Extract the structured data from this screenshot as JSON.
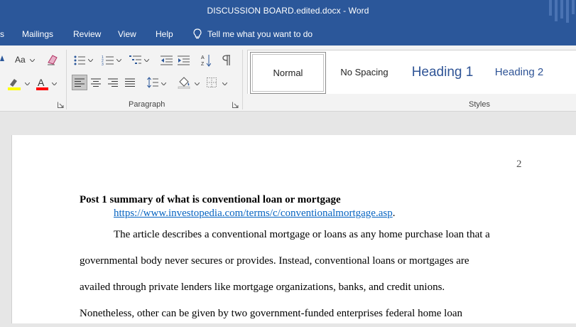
{
  "window": {
    "title": "DISCUSSION BOARD.edited.docx  -  Word"
  },
  "ribbon_tabs": [
    {
      "label": "s"
    },
    {
      "label": "Mailings"
    },
    {
      "label": "Review"
    },
    {
      "label": "View"
    },
    {
      "label": "Help"
    }
  ],
  "tell_me": {
    "label": "Tell me what you want to do"
  },
  "font_group": {
    "case_label": "Aa",
    "highlight_color": "#ffff00",
    "font_color": "#ff0000"
  },
  "groups": {
    "paragraph": "Paragraph",
    "styles": "Styles"
  },
  "styles": [
    {
      "label": "Normal",
      "selected": true
    },
    {
      "label": "No Spacing"
    },
    {
      "label": "Heading 1"
    },
    {
      "label": "Heading 2"
    }
  ],
  "document": {
    "page_number": "2",
    "heading": "Post 1 summary of what is conventional loan or mortgage",
    "link": "https://www.investopedia.com/terms/c/conventionalmortgage.asp",
    "link_suffix": ".",
    "lines": [
      "The article describes a conventional mortgage or loans as any home purchase loan that a",
      "governmental body never secures or provides. Instead, conventional loans or mortgages are",
      "availed through private lenders like mortgage organizations, banks, and credit unions.",
      "Nonetheless, other can be given by two government-funded enterprises federal home loan"
    ]
  },
  "colors": {
    "title_bar": "#2b579a",
    "heading_style": "#2f5496",
    "link": "#0563c1"
  }
}
